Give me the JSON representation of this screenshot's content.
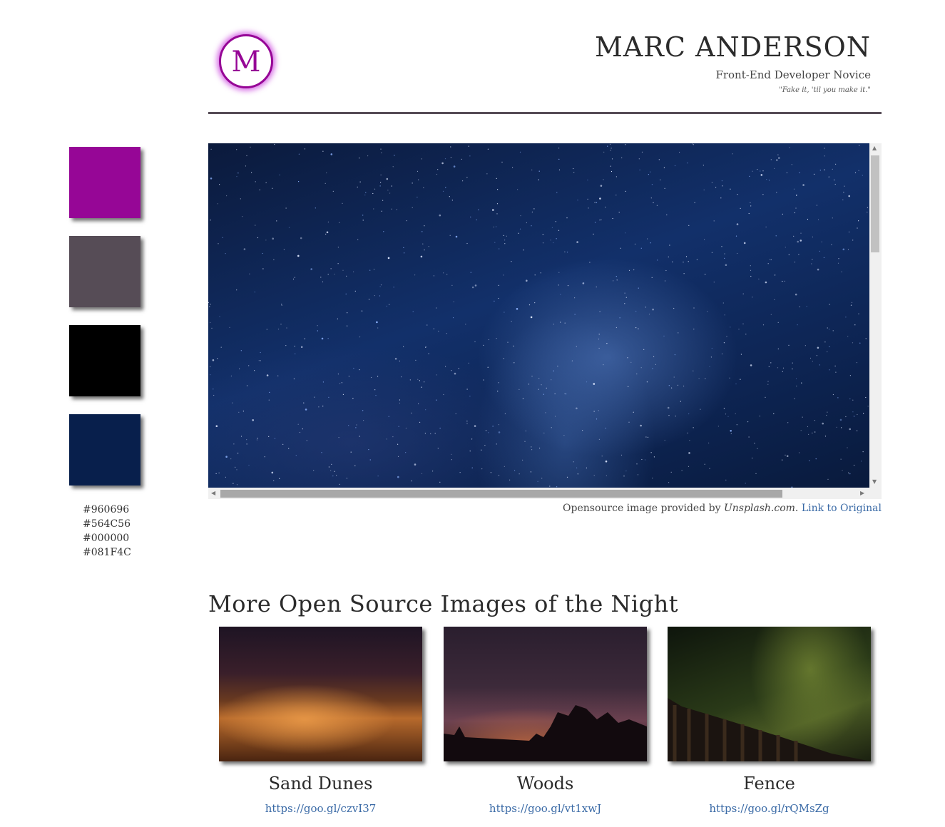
{
  "header": {
    "logo_letter": "M",
    "name": "MARC ANDERSON",
    "role": "Front-End Developer Novice",
    "quote": "\"Fake it, 'til you make it.\""
  },
  "palette": [
    {
      "hex": "#960696"
    },
    {
      "hex": "#564C56"
    },
    {
      "hex": "#000000"
    },
    {
      "hex": "#081F4C"
    }
  ],
  "main_image": {
    "subject": "starry night sky",
    "credit_prefix": "Opensource image provided by",
    "credit_source": "Unsplash.com.",
    "credit_link": "Link to Original"
  },
  "gallery": {
    "title": "More Open Source Images of the Night",
    "items": [
      {
        "title": "Sand Dunes",
        "link": "https://goo.gl/czvI37"
      },
      {
        "title": "Woods",
        "link": "https://goo.gl/vt1xwJ"
      },
      {
        "title": "Fence",
        "link": "https://goo.gl/rQMsZg"
      }
    ]
  }
}
